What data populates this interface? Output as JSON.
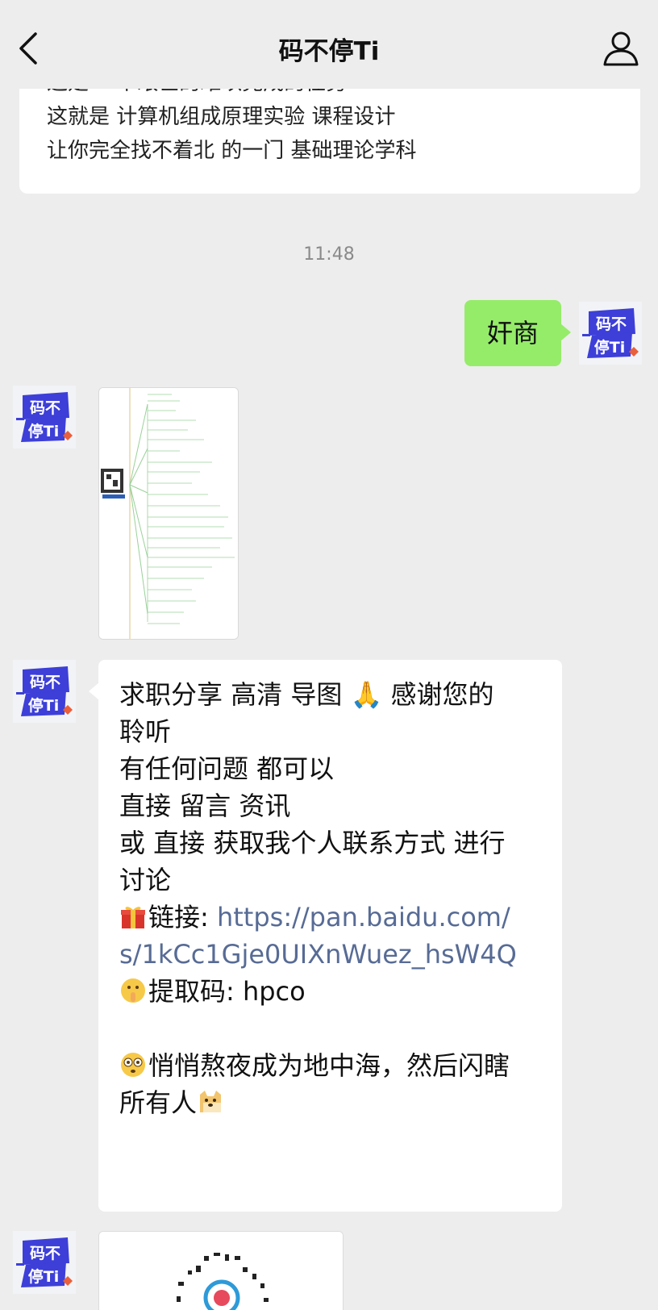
{
  "header": {
    "title": "码不停Ti",
    "back_icon": "chevron-left-icon",
    "profile_icon": "person-icon"
  },
  "top_message": {
    "lines": [
      "这是 一个艰巨的难以完成的任务",
      "这就是 计算机组成原理实验 课程设计",
      "让你完全找不着北 的一门 基础理论学科"
    ]
  },
  "timestamp": "11:48",
  "outgoing": {
    "text": "奸商"
  },
  "avatar": {
    "line1": "码不",
    "line2": "停Ti"
  },
  "incoming": {
    "lines": [
      "求职分享 高清 导图 🙏 感谢您的",
      "聆听",
      "有任何问题 都可以",
      "直接 留言 资讯",
      "或 直接 获取我个人联系方式 进行",
      "讨论"
    ],
    "link_label": "链接: ",
    "link_part1": "https://pan.baidu.com/",
    "link_part2": "s/1kCc1Gje0UIXnWuez_hsW4Q",
    "code_label": "提取码: hpco",
    "closing_line1": "悄悄熬夜成为地中海，然后闪瞎",
    "closing_line2": "所有人"
  },
  "colors": {
    "background": "#ededed",
    "outgoing_bubble": "#95ec69",
    "link": "#576b95",
    "avatar_blue": "#3d3fd8",
    "avatar_accent": "#e8603c"
  }
}
